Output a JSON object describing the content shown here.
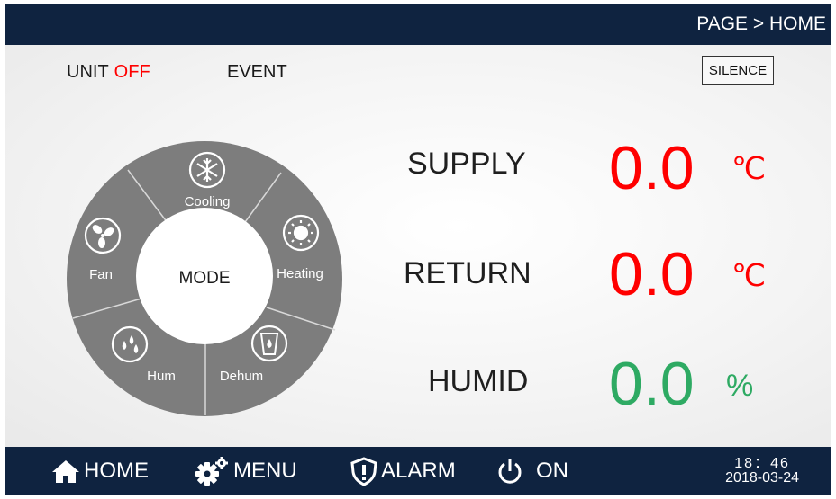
{
  "header": {
    "breadcrumb": "PAGE > HOME"
  },
  "status": {
    "unit_label": "UNIT",
    "unit_value": "OFF",
    "event_label": "EVENT",
    "silence_label": "SILENCE"
  },
  "mode_wheel": {
    "center_label": "MODE",
    "modes": [
      {
        "label": "Cooling",
        "icon": "snowflake-icon"
      },
      {
        "label": "Heating",
        "icon": "sun-icon"
      },
      {
        "label": "Dehum",
        "icon": "water-cup-icon"
      },
      {
        "label": "Hum",
        "icon": "water-drops-icon"
      },
      {
        "label": "Fan",
        "icon": "fan-icon"
      }
    ]
  },
  "readings": [
    {
      "label": "SUPPLY",
      "value": "0.0",
      "unit": "℃",
      "color": "#ff0000"
    },
    {
      "label": "RETURN",
      "value": "0.0",
      "unit": "℃",
      "color": "#ff0000"
    },
    {
      "label": "HUMID",
      "value": "0.0",
      "unit": "%",
      "color": "#2eaa63"
    }
  ],
  "footer": {
    "home_label": "HOME",
    "menu_label": "MENU",
    "alarm_label": "ALARM",
    "power_label": "ON",
    "time": "18：46",
    "date": "2018-03-24"
  },
  "colors": {
    "bar": "#0f2340",
    "wheel": "#7d7d7d",
    "alert": "#ff0000",
    "ok": "#2eaa63"
  }
}
